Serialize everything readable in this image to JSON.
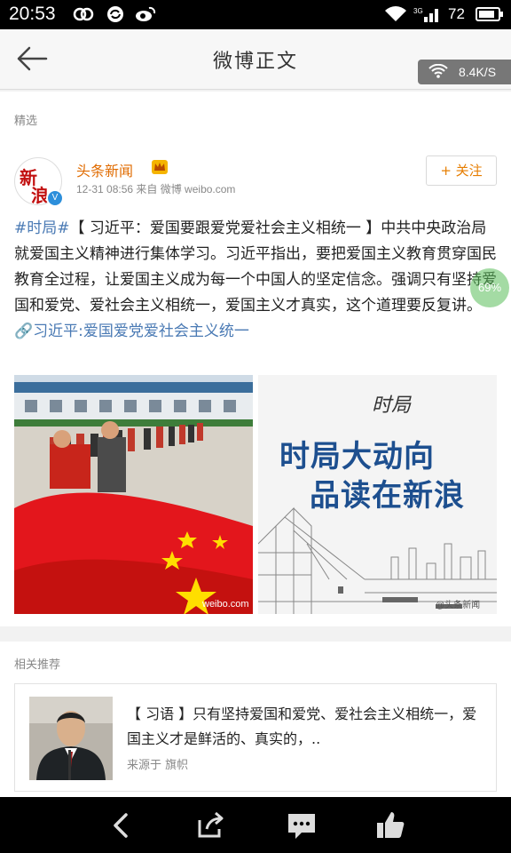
{
  "status_bar": {
    "time": "20:53",
    "battery": "72"
  },
  "header": {
    "title": "微博正文",
    "more": "•••",
    "net_speed": "8.4K/S"
  },
  "post": {
    "section_label": "精选",
    "author": "头条新闻",
    "avatar_text_top": "新",
    "avatar_text_bottom": "浪",
    "verified_mark": "V",
    "meta": "12-31 08:56  来自 微博 weibo.com",
    "follow_label": "+ 关注",
    "body_tag": "#时局#",
    "body_main": "【 习近平：爱国要跟爱党爱社会主义相统一 】中共中央政治局就爱国主义精神进行集体学习。习近平指出，要把爱国主义教育贯穿国民教育全过程，让爱国主义成为每一个中国人的坚定信念。强调只有坚持爱国和爱党、爱社会主义相统一，爱国主义才真实，这个道理要反复讲。",
    "body_link": "🔗习近平:爱国爱党爱社会主义统一",
    "image1_watermark": "weibo.com",
    "image2_calligraphy": "时局",
    "image2_line1": "时局大动向",
    "image2_line2": "品读在新浪",
    "image2_watermark": "@头条新闻"
  },
  "overlay_percent": "69%",
  "related": {
    "section_label": "相关推荐",
    "text": "【 习语 】只有坚持爱国和爱党、爱社会主义相统一，爱国主义才是鲜活的、真实的，..",
    "source": "来源于 旗帜"
  },
  "colors": {
    "accent_orange": "#e67d00",
    "link_blue": "#4a7ab4",
    "image_blue": "#1d4f8f"
  }
}
